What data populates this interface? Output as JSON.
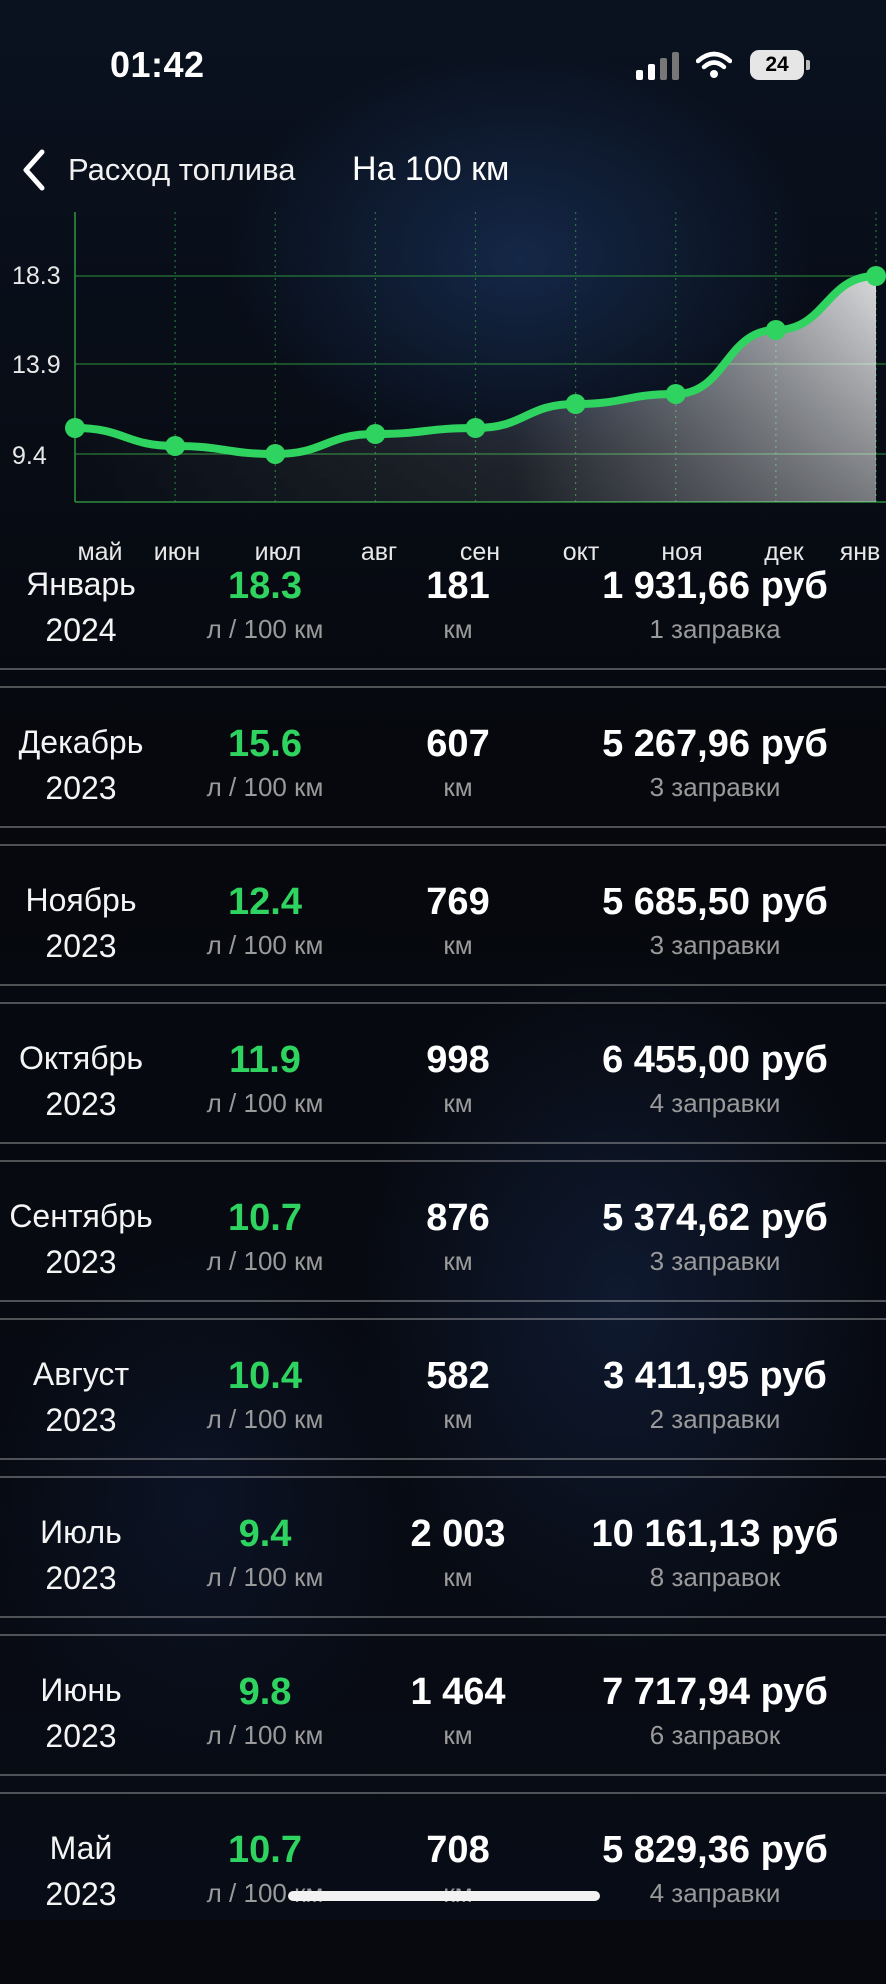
{
  "status_bar": {
    "time": "01:42",
    "battery": "24"
  },
  "nav": {
    "back_title": "Расход топлива",
    "mode": "На 100 км"
  },
  "colors": {
    "accent_green": "#2fd35f",
    "background": "#07090e",
    "muted": "#9a9a9a"
  },
  "chart_data": {
    "type": "area",
    "categories": [
      "май",
      "июн",
      "июл",
      "авг",
      "сен",
      "окт",
      "ноя",
      "дек",
      "янв"
    ],
    "values": [
      10.7,
      9.8,
      9.4,
      10.4,
      10.7,
      11.9,
      12.4,
      15.6,
      18.3
    ],
    "yticks": [
      "18.3",
      "13.9",
      "9.4"
    ],
    "ylim": [
      7.0,
      21.5
    ],
    "grid": true,
    "title": "",
    "xlabel": "",
    "ylabel": ""
  },
  "rows": [
    {
      "month": "Январь",
      "year": "2024",
      "consumption": "18.3",
      "unit": "л / 100 км",
      "km": "181",
      "km_unit": "км",
      "cost": "1 931,66 руб",
      "fills": "1 заправка"
    },
    {
      "month": "Декабрь",
      "year": "2023",
      "consumption": "15.6",
      "unit": "л / 100 км",
      "km": "607",
      "km_unit": "км",
      "cost": "5 267,96 руб",
      "fills": "3 заправки"
    },
    {
      "month": "Ноябрь",
      "year": "2023",
      "consumption": "12.4",
      "unit": "л / 100 км",
      "km": "769",
      "km_unit": "км",
      "cost": "5 685,50 руб",
      "fills": "3 заправки"
    },
    {
      "month": "Октябрь",
      "year": "2023",
      "consumption": "11.9",
      "unit": "л / 100 км",
      "km": "998",
      "km_unit": "км",
      "cost": "6 455,00 руб",
      "fills": "4 заправки"
    },
    {
      "month": "Сентябрь",
      "year": "2023",
      "consumption": "10.7",
      "unit": "л / 100 км",
      "km": "876",
      "km_unit": "км",
      "cost": "5 374,62 руб",
      "fills": "3 заправки"
    },
    {
      "month": "Август",
      "year": "2023",
      "consumption": "10.4",
      "unit": "л / 100 км",
      "km": "582",
      "km_unit": "км",
      "cost": "3 411,95 руб",
      "fills": "2 заправки"
    },
    {
      "month": "Июль",
      "year": "2023",
      "consumption": "9.4",
      "unit": "л / 100 км",
      "km": "2 003",
      "km_unit": "км",
      "cost": "10 161,13 руб",
      "fills": "8 заправок"
    },
    {
      "month": "Июнь",
      "year": "2023",
      "consumption": "9.8",
      "unit": "л / 100 км",
      "km": "1 464",
      "km_unit": "км",
      "cost": "7 717,94 руб",
      "fills": "6 заправок"
    },
    {
      "month": "Май",
      "year": "2023",
      "consumption": "10.7",
      "unit": "л / 100 км",
      "km": "708",
      "km_unit": "км",
      "cost": "5 829,36 руб",
      "fills": "4 заправки"
    }
  ]
}
